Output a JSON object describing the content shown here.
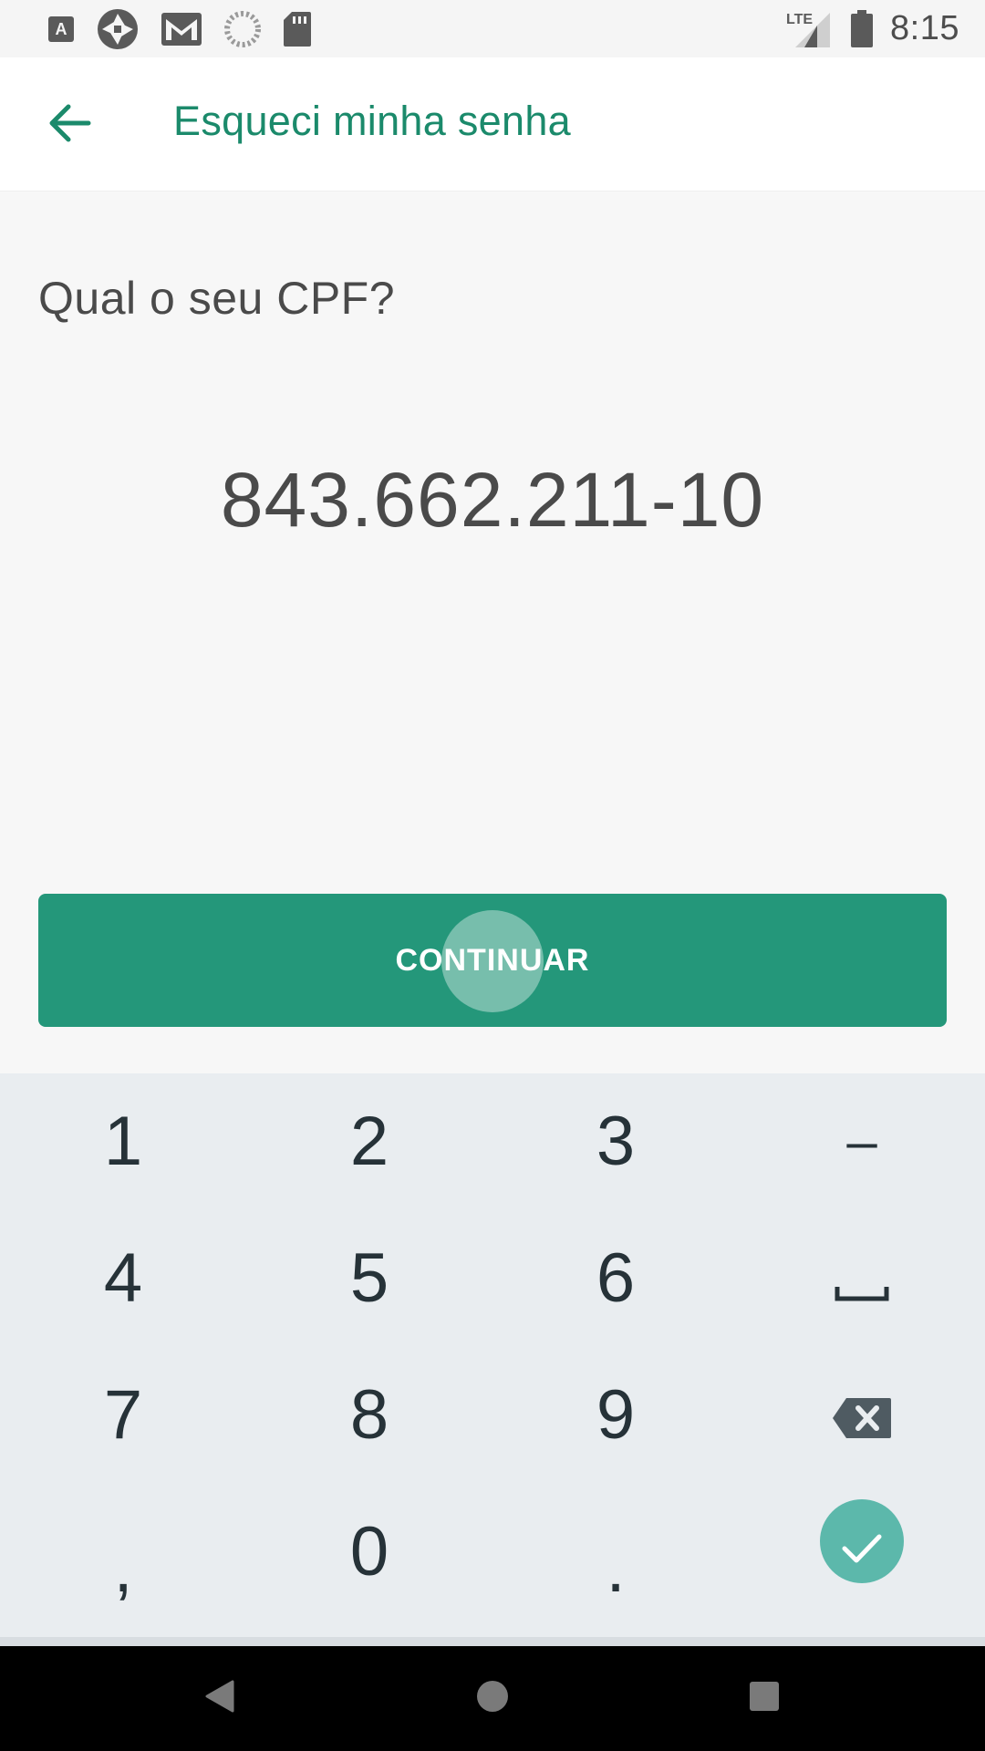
{
  "status_bar": {
    "time": "8:15",
    "network": "LTE",
    "left_icons": [
      "font-a-icon",
      "camera-shutter-icon",
      "gmail-icon",
      "loading-circle-icon",
      "sd-card-icon"
    ],
    "right_icons": [
      "lte-signal-icon",
      "battery-icon"
    ]
  },
  "app_bar": {
    "title": "Esqueci minha senha",
    "accent_color": "#1b8a6b"
  },
  "form": {
    "question": "Qual o seu CPF?",
    "cpf_value": "843.662.211-10"
  },
  "continue_button": {
    "label": "CONTINUAR",
    "color": "#24977a"
  },
  "keyboard": {
    "rows": [
      [
        {
          "label": "1"
        },
        {
          "label": "2"
        },
        {
          "label": "3"
        },
        {
          "label": "–"
        }
      ],
      [
        {
          "label": "4"
        },
        {
          "label": "5"
        },
        {
          "label": "6"
        },
        {
          "icon": "space-icon"
        }
      ],
      [
        {
          "label": "7"
        },
        {
          "label": "8"
        },
        {
          "label": "9"
        },
        {
          "icon": "backspace-icon"
        }
      ],
      [
        {
          "label": ","
        },
        {
          "label": "0"
        },
        {
          "label": "."
        },
        {
          "icon": "check-icon"
        }
      ]
    ],
    "enter_color": "#5cb8ab"
  },
  "nav_bar": {
    "icons": [
      "back-triangle-icon",
      "home-circle-icon",
      "recents-square-icon"
    ]
  }
}
